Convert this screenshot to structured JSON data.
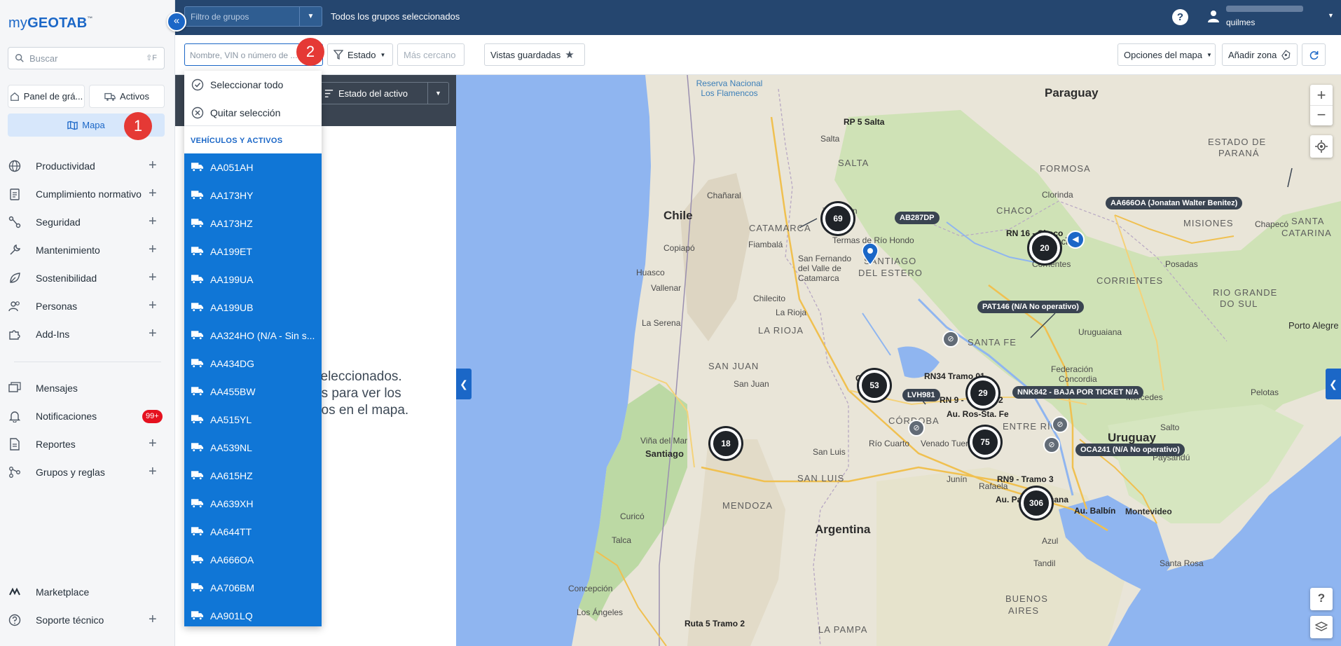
{
  "sidebar": {
    "logo_my": "my",
    "logo_main": "GEOTAB",
    "logo_tm": "™",
    "search_placeholder": "Buscar",
    "search_shortcut": "⇧F",
    "tabs": {
      "dashboard": "Panel de grá...",
      "assets": "Activos",
      "map": "Mapa"
    },
    "nav": [
      {
        "label": "Productividad",
        "icon": "globe-icon",
        "expandable": true
      },
      {
        "label": "Cumplimiento normativo",
        "icon": "clipboard-icon",
        "expandable": true
      },
      {
        "label": "Seguridad",
        "icon": "road-icon",
        "expandable": true
      },
      {
        "label": "Mantenimiento",
        "icon": "wrench-icon",
        "expandable": true
      },
      {
        "label": "Sostenibilidad",
        "icon": "leaf-icon",
        "expandable": true
      },
      {
        "label": "Personas",
        "icon": "people-icon",
        "expandable": true
      },
      {
        "label": "Add-Ins",
        "icon": "puzzle-icon",
        "expandable": true
      }
    ],
    "nav2": [
      {
        "label": "Mensajes",
        "icon": "messages-icon",
        "expandable": false
      },
      {
        "label": "Notificaciones",
        "icon": "bell-icon",
        "badge": "99+"
      },
      {
        "label": "Reportes",
        "icon": "report-icon",
        "expandable": true
      },
      {
        "label": "Grupos y reglas",
        "icon": "hierarchy-icon",
        "expandable": true
      }
    ],
    "bottom": [
      {
        "label": "Marketplace",
        "icon": "marketplace-icon"
      },
      {
        "label": "Soporte técnico",
        "icon": "support-icon",
        "expandable": true
      }
    ]
  },
  "annotations": {
    "one": "1",
    "two": "2"
  },
  "topbar": {
    "group_filter_placeholder": "Filtro de grupos",
    "all_groups": "Todos los grupos seleccionados",
    "help": "?",
    "user": "quilmes"
  },
  "toolbar": {
    "search_placeholder": "Nombre, VIN o número de ...",
    "estado": "Estado",
    "mas_cercano": "Más cercano",
    "vistas": "Vistas guardadas",
    "opciones": "Opciones del mapa",
    "zona": "Añadir zona"
  },
  "dropdown": {
    "select_all": "Seleccionar todo",
    "clear": "Quitar selección",
    "section": "VEHÍCULOS Y ACTIVOS",
    "items": [
      "AA051AH",
      "AA173HY",
      "AA173HZ",
      "AA199ET",
      "AA199UA",
      "AA199UB",
      "AA324HO (N/A - Sin s...",
      "AA434DG",
      "AA455BW",
      "AA515YL",
      "AA539NL",
      "AA615HZ",
      "AA639XH",
      "AA644TT",
      "AA666OA",
      "AA706BM",
      "AA901LQ"
    ]
  },
  "panel": {
    "sort_label": "Estado del activo",
    "empty_line1": "seleccionados.",
    "empty_line2": "os para ver los",
    "empty_line3": "rlos en el mapa."
  },
  "map": {
    "countries": [
      {
        "label": "Paraguay"
      },
      {
        "label": "Chile"
      },
      {
        "label": "Argentina"
      },
      {
        "label": "Uruguay"
      }
    ],
    "provinces": [
      {
        "label": "SALTA"
      },
      {
        "label": "CATAMARCA"
      },
      {
        "label": "SANTIAGO"
      },
      {
        "label": "DEL ESTERO"
      },
      {
        "label": "CHACO"
      },
      {
        "label": "FORMOSA"
      },
      {
        "label": "CORRIENTES"
      },
      {
        "label": "MISIONES"
      },
      {
        "label": "LA RIOJA"
      },
      {
        "label": "SAN JUAN"
      },
      {
        "label": "SANTA FE"
      },
      {
        "label": "CÓRDOBA"
      },
      {
        "label": "ENTRE RÍOS"
      },
      {
        "label": "SAN LUIS"
      },
      {
        "label": "MENDOZA"
      },
      {
        "label": "LA PAMPA"
      },
      {
        "label": "BUENOS"
      },
      {
        "label": "AIRES"
      },
      {
        "label": "ESTADO DE"
      },
      {
        "label": "PARANÁ"
      },
      {
        "label": "SANTA"
      },
      {
        "label": "CATARINA"
      },
      {
        "label": "RIO GRANDE"
      },
      {
        "label": "DO SUL"
      }
    ],
    "cities": [
      {
        "label": "Salta"
      },
      {
        "label": "Asunción"
      },
      {
        "label": "Chañaral"
      },
      {
        "label": "Copiapó"
      },
      {
        "label": "Fiambalá"
      },
      {
        "label": "Huasco"
      },
      {
        "label": "Vallenar"
      },
      {
        "label": "La Serena"
      },
      {
        "label": "Chilecito"
      },
      {
        "label": "La Rioja"
      },
      {
        "label": "San Juan"
      },
      {
        "label": "Viña del Mar"
      },
      {
        "label": "Santiago"
      },
      {
        "label": "Curicó"
      },
      {
        "label": "Talca"
      },
      {
        "label": "Concepción"
      },
      {
        "label": "Los Ángeles"
      },
      {
        "label": "Río Cuarto"
      },
      {
        "label": "San Luis"
      },
      {
        "label": "Venado Tuerto"
      },
      {
        "label": "Rosario"
      },
      {
        "label": "Montevideo"
      },
      {
        "label": "Porto Alegre"
      },
      {
        "label": "Pelotas"
      },
      {
        "label": "Chapecó"
      },
      {
        "label": "Uruguaiana"
      },
      {
        "label": "Concordia"
      },
      {
        "label": "Federación"
      },
      {
        "label": "Reconquista"
      },
      {
        "label": "Villa María"
      },
      {
        "label": "San Rafael"
      },
      {
        "label": "General Alvear"
      },
      {
        "label": "Santa Rosa"
      },
      {
        "label": "Bahía Blanca"
      },
      {
        "label": "Tandil"
      },
      {
        "label": "Olavarría"
      },
      {
        "label": "Necochea"
      },
      {
        "label": "Azul"
      },
      {
        "label": "Tres Arroyos"
      },
      {
        "label": "Junín"
      },
      {
        "label": "Pergamino"
      },
      {
        "label": "Chivilcoy"
      },
      {
        "label": "Santa Maria"
      },
      {
        "label": "Santo Angelo"
      },
      {
        "label": "Passo Fundo"
      },
      {
        "label": "Caxias do Sul"
      },
      {
        "label": "Lages"
      },
      {
        "label": "Posadas"
      },
      {
        "label": "Corrientes"
      },
      {
        "label": "Resistencia"
      },
      {
        "label": "Clorinda"
      },
      {
        "label": "Encarnación"
      },
      {
        "label": "Ciudad del Este"
      },
      {
        "label": "Mercedes"
      },
      {
        "label": "Goya"
      },
      {
        "label": "Paraná"
      },
      {
        "label": "Santa Fe"
      },
      {
        "label": "Rafaela"
      },
      {
        "label": "Paysandú"
      },
      {
        "label": "Salto"
      },
      {
        "label": "Tacuarembó"
      },
      {
        "label": "Rivera"
      },
      {
        "label": "Melo"
      },
      {
        "label": "Termas de Río Hondo"
      },
      {
        "label": "San Fernando del Valle de Catamarca"
      },
      {
        "label": "Tucumán"
      },
      {
        "label": "Mar del Plata"
      }
    ],
    "roads": [
      {
        "label": "RP 5 Salta"
      },
      {
        "label": "RN 16 - Chaco"
      },
      {
        "label": "RN34 Tramo 01"
      },
      {
        "label": "RN 9 - Tramo 02"
      },
      {
        "label": "Au. Ros-Sta. Fe"
      },
      {
        "label": "RN9 - Tramo 3"
      },
      {
        "label": "Au. Panamericana"
      },
      {
        "label": "Au. Balbín"
      },
      {
        "label": "Ruta 5 Tramo 2"
      },
      {
        "label": "Córdoba"
      },
      {
        "label": "Santiago"
      }
    ],
    "water": [
      {
        "label": "Reserva Nacional Los Flamencos"
      }
    ],
    "clusters": [
      "69",
      "20",
      "53",
      "29",
      "75",
      "18",
      "306"
    ],
    "vehicle_labels": [
      "AA666OA (Jonatan Walter Benitez)",
      "AB287DP",
      "PAT146 (N/A No operativo)",
      "LVH981",
      "NNK842 - BAJA POR TICKET N/A",
      "OCA241 (N/A No operativo)"
    ],
    "zoom_in": "+",
    "zoom_out": "−",
    "help": "?"
  }
}
